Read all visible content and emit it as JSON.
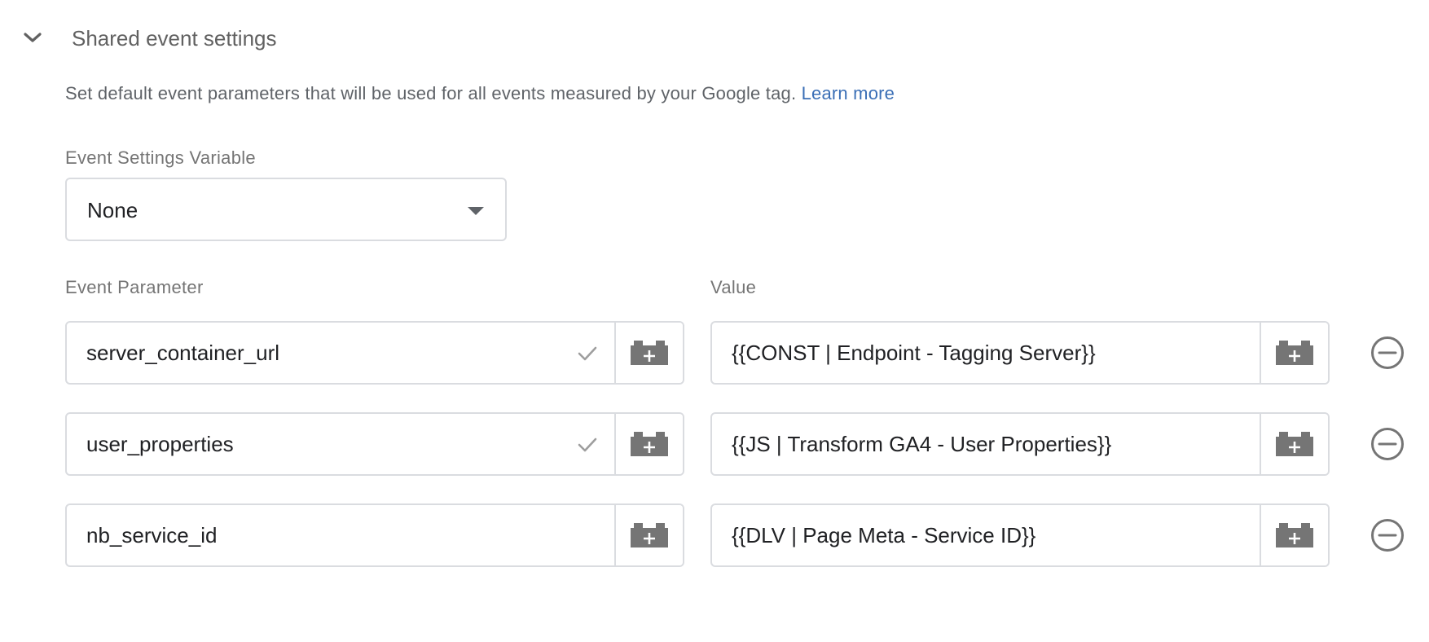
{
  "section": {
    "title": "Shared event settings",
    "description": "Set default event parameters that will be used for all events measured by your Google tag.",
    "learn_more": "Learn more"
  },
  "event_settings_variable": {
    "label": "Event Settings Variable",
    "value": "None"
  },
  "columns": {
    "parameter_label": "Event Parameter",
    "value_label": "Value"
  },
  "rows": [
    {
      "parameter": "server_container_url",
      "value": "{{CONST | Endpoint - Tagging Server}}",
      "validated": true
    },
    {
      "parameter": "user_properties",
      "value": "{{JS | Transform GA4 - User Properties}}",
      "validated": true
    },
    {
      "parameter": "nb_service_id",
      "value": "{{DLV | Page Meta - Service ID}}",
      "validated": false
    }
  ],
  "icons": {
    "collapse": "chevron-down-icon",
    "dropdown": "dropdown-arrow-icon",
    "valid": "check-icon",
    "variable_picker": "variable-brick-icon",
    "remove": "remove-circle-icon"
  },
  "colors": {
    "link": "#3b6fb6",
    "border": "#dadce0",
    "icon": "#757575"
  }
}
